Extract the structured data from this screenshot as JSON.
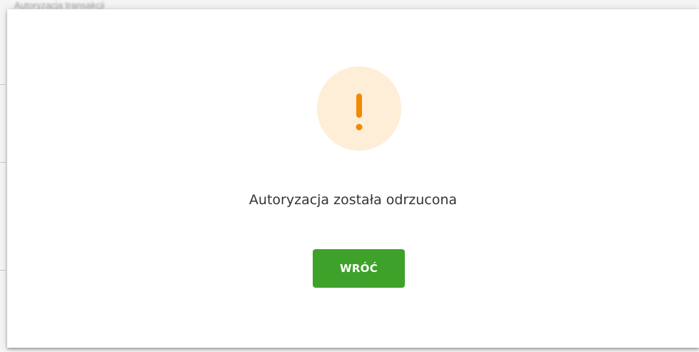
{
  "background": {
    "blurred_text": "Autoryzacja transakcji"
  },
  "dialog": {
    "icon": "exclamation-icon",
    "message": "Autoryzacja została odrzucona",
    "back_button_label": "WRÓĆ"
  },
  "colors": {
    "accent_green": "#3ea22a",
    "warning_orange": "#f08a00",
    "warning_circle_bg": "#feeed8",
    "text": "#333333"
  }
}
